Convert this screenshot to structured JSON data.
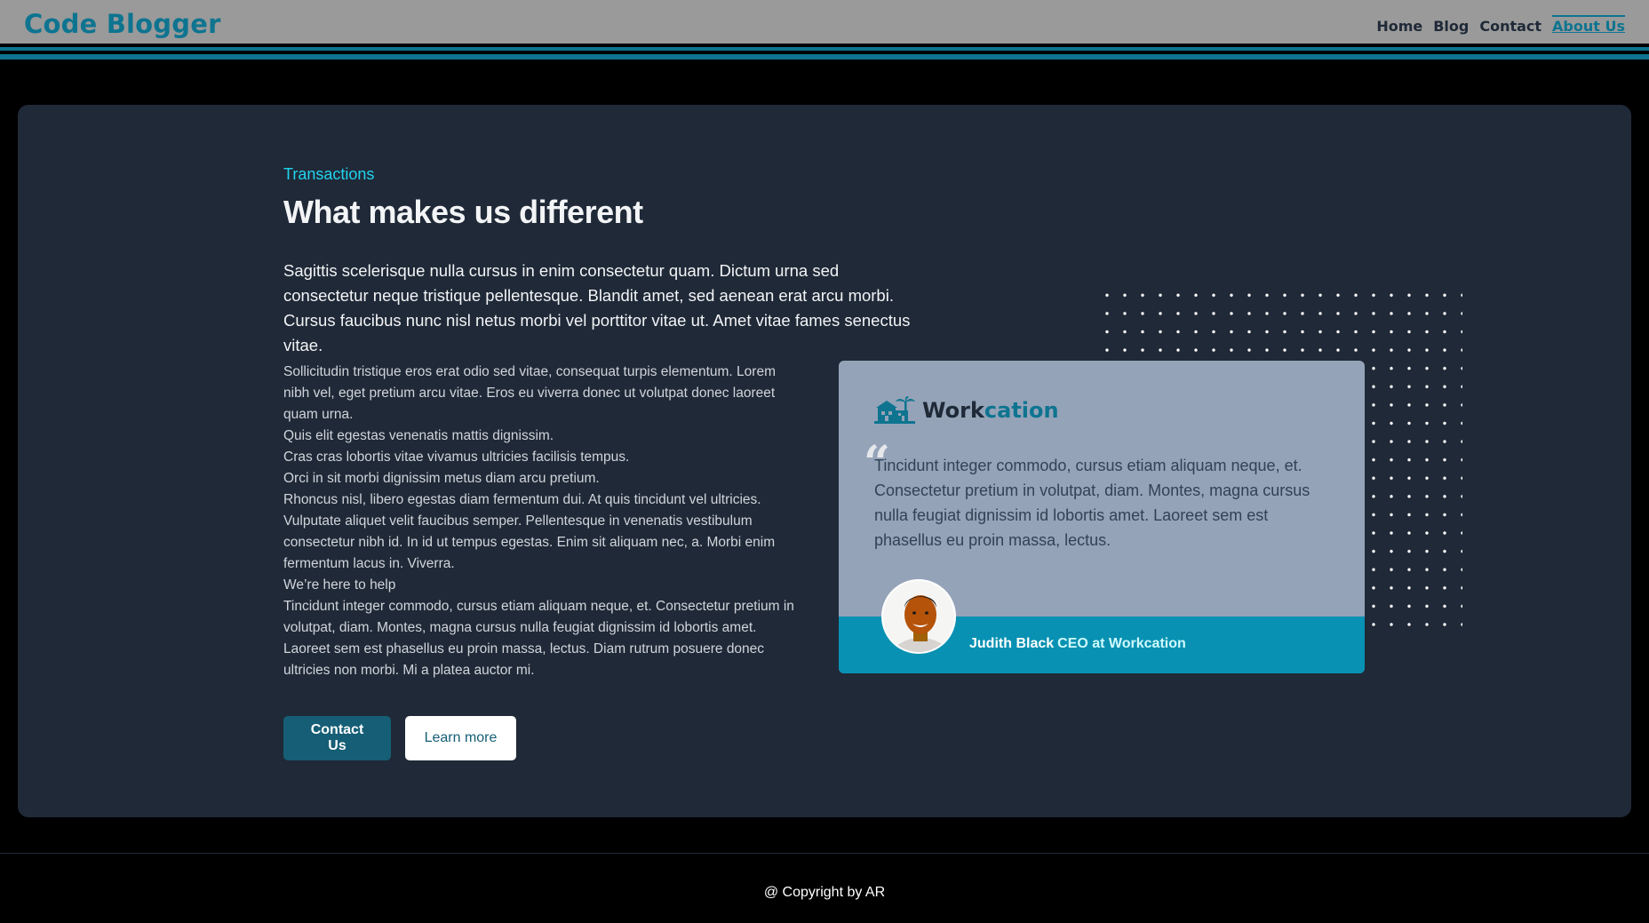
{
  "header": {
    "brand": "Code Blogger",
    "nav": [
      {
        "label": "Home"
      },
      {
        "label": "Blog"
      },
      {
        "label": "Contact"
      },
      {
        "label": "About Us"
      }
    ]
  },
  "main": {
    "eyebrow": "Transactions",
    "title": "What makes us different",
    "lead": "Sagittis scelerisque nulla cursus in enim consectetur quam. Dictum urna sed consectetur neque tristique pellentesque. Blandit amet, sed aenean erat arcu morbi. Cursus faucibus nunc nisl netus morbi vel porttitor vitae ut. Amet vitae fames senectus vitae.",
    "body": [
      "Sollicitudin tristique eros erat odio sed vitae, consequat turpis elementum. Lorem nibh vel, eget pretium arcu vitae. Eros eu viverra donec ut volutpat donec laoreet quam urna.",
      "Quis elit egestas venenatis mattis dignissim.",
      "Cras cras lobortis vitae vivamus ultricies facilisis tempus.",
      "Orci in sit morbi dignissim metus diam arcu pretium.",
      "Rhoncus nisl, libero egestas diam fermentum dui. At quis tincidunt vel ultricies. Vulputate aliquet velit faucibus semper. Pellentesque in venenatis vestibulum consectetur nibh id. In id ut tempus egestas. Enim sit aliquam nec, a. Morbi enim fermentum lacus in. Viverra.",
      "We’re here to help",
      "Tincidunt integer commodo, cursus etiam aliquam neque, et. Consectetur pretium in volutpat, diam. Montes, magna cursus nulla feugiat dignissim id lobortis amet. Laoreet sem est phasellus eu proin massa, lectus. Diam rutrum posuere donec ultricies non morbi. Mi a platea auctor mi."
    ],
    "buttons": {
      "contact": "Contact Us",
      "learn_more": "Learn more"
    }
  },
  "testimonial": {
    "logo_prefix": "Work",
    "logo_suffix": "cation",
    "quote_mark": "“",
    "quote": "Tincidunt integer commodo, cursus etiam aliquam neque, et. Consectetur pretium in volutpat, diam. Montes, magna cursus nulla feugiat dignissim id lobortis amet. Laoreet sem est phasellus eu proin massa, lectus.",
    "author_name": "Judith Black",
    "author_role": "CEO at Workcation"
  },
  "footer": {
    "copyright": "@ Copyright by AR"
  },
  "colors": {
    "accent": "#0e7490",
    "cyan": "#22d3ee",
    "card_bg": "#1f2937",
    "testimonial_bg": "#94a3b8",
    "testimonial_footer": "#0891b2"
  }
}
